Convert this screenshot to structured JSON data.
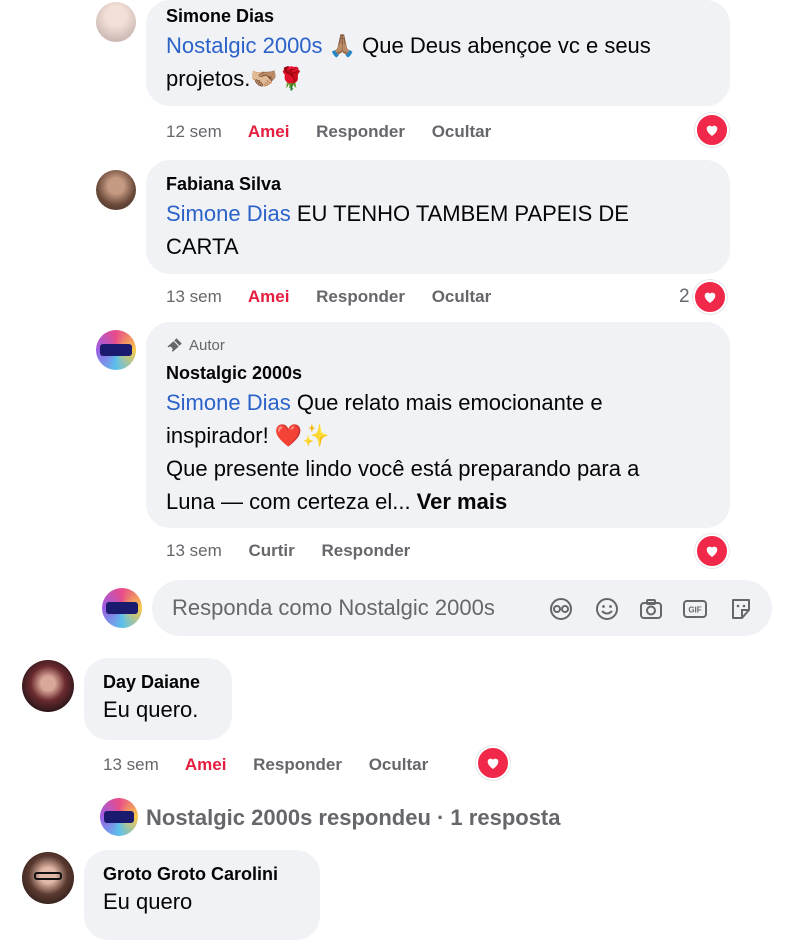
{
  "comments": [
    {
      "name": "Simone Dias",
      "mention": "Nostalgic 2000s",
      "text_line1": " 🙏🏽 Que Deus abençoe vc e seus",
      "text_line2": "projetos.🫱🏼‍🫲🏽🌹",
      "time": "12 sem",
      "like": "Amei",
      "reply": "Responder",
      "hide": "Ocultar"
    },
    {
      "name": "Fabiana Silva",
      "mention": "Simone Dias",
      "text_line1": " EU TENHO TAMBEM PAPEIS DE",
      "text_line2": "CARTA",
      "time": "13 sem",
      "like": "Amei",
      "reply": "Responder",
      "hide": "Ocultar",
      "reaction_count": "2"
    },
    {
      "author_badge": "Autor",
      "name": "Nostalgic 2000s",
      "mention": "Simone Dias",
      "text_line1": " Que relato mais emocionante e",
      "text_line2": "inspirador! ❤️✨",
      "text_line3": "Que presente lindo você está preparando para a",
      "text_line4": "Luna — com certeza el... ",
      "see_more": "Ver mais",
      "time": "13 sem",
      "like": "Curtir",
      "reply": "Responder"
    },
    {
      "name": "Day Daiane",
      "text": "Eu quero.",
      "time": "13 sem",
      "like": "Amei",
      "reply": "Responder",
      "hide": "Ocultar"
    },
    {
      "name": "Groto Groto Carolini",
      "text": "Eu quero"
    }
  ],
  "reply_box": {
    "placeholder": "Responda como Nostalgic 2000s"
  },
  "replies_summary": "Nostalgic 2000s respondeu · 1 resposta",
  "colors": {
    "bubble": "#f0f2f5",
    "mention": "#2b62c9",
    "loved": "#e41e3f",
    "meta": "#65676b",
    "heart": "#f02849"
  },
  "icons": [
    "heart-icon",
    "microphone-icon",
    "avatar-sticker-icon",
    "emoji-icon",
    "camera-icon",
    "gif-icon",
    "sticker-icon"
  ]
}
